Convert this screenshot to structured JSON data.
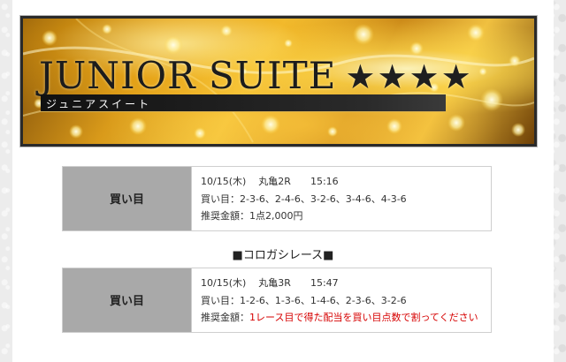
{
  "colors": {
    "label_cell_bg": "#a9a9a9",
    "table_border": "#cfcfcf",
    "highlight_text": "#d60000",
    "banner_gold": "#e6b233"
  },
  "banner": {
    "title": "JUNIOR SUITE",
    "stars": "★★★★",
    "subtitle": "ジュニアスイート"
  },
  "bets": [
    {
      "label": "買い目",
      "date": "10/15(木)",
      "race": "丸亀2R",
      "time": "15:16",
      "combos_label": "買い目：",
      "combos": "2-3-6、2-4-6、3-2-6、3-4-6、4-3-6",
      "amount_label": "推奨金額：",
      "amount": "1点2,000円"
    },
    {
      "label": "買い目",
      "date": "10/15(木)",
      "race": "丸亀3R",
      "time": "15:47",
      "combos_label": "買い目：",
      "combos": "1-2-6、1-3-6、1-4-6、2-3-6、3-2-6",
      "amount_label": "推奨金額：",
      "amount": "1レース目で得た配当を買い目点数で割ってください"
    }
  ],
  "section_heading": "■コロガシレース■"
}
